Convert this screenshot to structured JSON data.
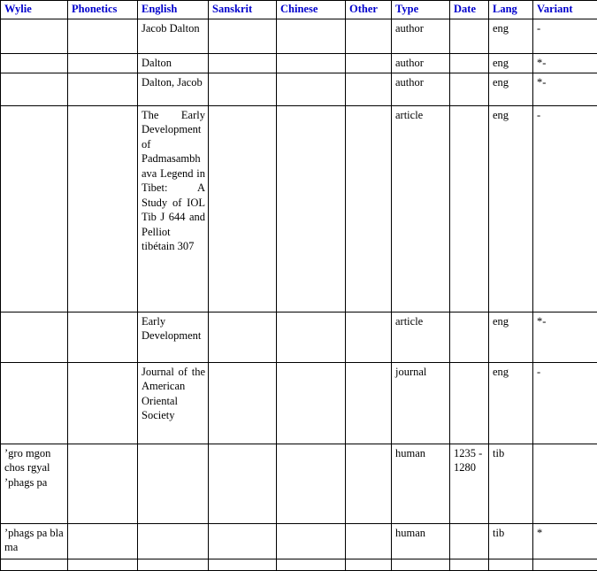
{
  "table": {
    "columns": [
      {
        "key": "wylie",
        "label": "Wylie"
      },
      {
        "key": "phonetics",
        "label": "Phonetics"
      },
      {
        "key": "english",
        "label": "English"
      },
      {
        "key": "sanskrit",
        "label": "Sanskrit"
      },
      {
        "key": "chinese",
        "label": "Chinese"
      },
      {
        "key": "other",
        "label": "Other"
      },
      {
        "key": "type",
        "label": "Type"
      },
      {
        "key": "date",
        "label": "Date"
      },
      {
        "key": "lang",
        "label": "Lang"
      },
      {
        "key": "variant",
        "label": "Variant"
      }
    ],
    "header_color": "#0000cc",
    "border_color": "#000000",
    "rows": [
      {
        "wylie": "",
        "phonetics": "",
        "english": "Jacob Dalton",
        "sanskrit": "",
        "chinese": "",
        "other": "",
        "type": "author",
        "date": "",
        "lang": "eng",
        "variant": "-"
      },
      {
        "wylie": "",
        "phonetics": "",
        "english": "Dalton",
        "sanskrit": "",
        "chinese": "",
        "other": "",
        "type": "author",
        "date": "",
        "lang": "eng",
        "variant": "*-"
      },
      {
        "wylie": "",
        "phonetics": "",
        "english": "Dalton, Jacob",
        "sanskrit": "",
        "chinese": "",
        "other": "",
        "type": "author",
        "date": "",
        "lang": "eng",
        "variant": "*-"
      },
      {
        "wylie": "",
        "phonetics": "",
        "english": "The Early Development of Padmasambhava Legend in Tibet: A Study of IOL Tib J 644 and Pelliot tibétain 307",
        "sanskrit": "",
        "chinese": "",
        "other": "",
        "type": "article",
        "date": "",
        "lang": "eng",
        "variant": "-"
      },
      {
        "wylie": "",
        "phonetics": "",
        "english": "Early Development",
        "sanskrit": "",
        "chinese": "",
        "other": "",
        "type": "article",
        "date": "",
        "lang": "eng",
        "variant": "*-"
      },
      {
        "wylie": "",
        "phonetics": "",
        "english": "Journal of the American Oriental Society",
        "sanskrit": "",
        "chinese": "",
        "other": "",
        "type": "journal",
        "date": "",
        "lang": "eng",
        "variant": "-"
      },
      {
        "wylie": "ʼgro mgon chos rgyal ʼphags pa",
        "phonetics": "",
        "english": "",
        "sanskrit": "",
        "chinese": "",
        "other": "",
        "type": "human",
        "date": "1235 - 1280",
        "lang": "tib",
        "variant": ""
      },
      {
        "wylie": "ʼphags pa bla ma",
        "phonetics": "",
        "english": "",
        "sanskrit": "",
        "chinese": "",
        "other": "",
        "type": "human",
        "date": "",
        "lang": "tib",
        "variant": "*"
      },
      {
        "wylie": "",
        "phonetics": "",
        "english": "",
        "sanskrit": "",
        "chinese": "",
        "other": "",
        "type": "",
        "date": "",
        "lang": "",
        "variant": ""
      }
    ]
  }
}
